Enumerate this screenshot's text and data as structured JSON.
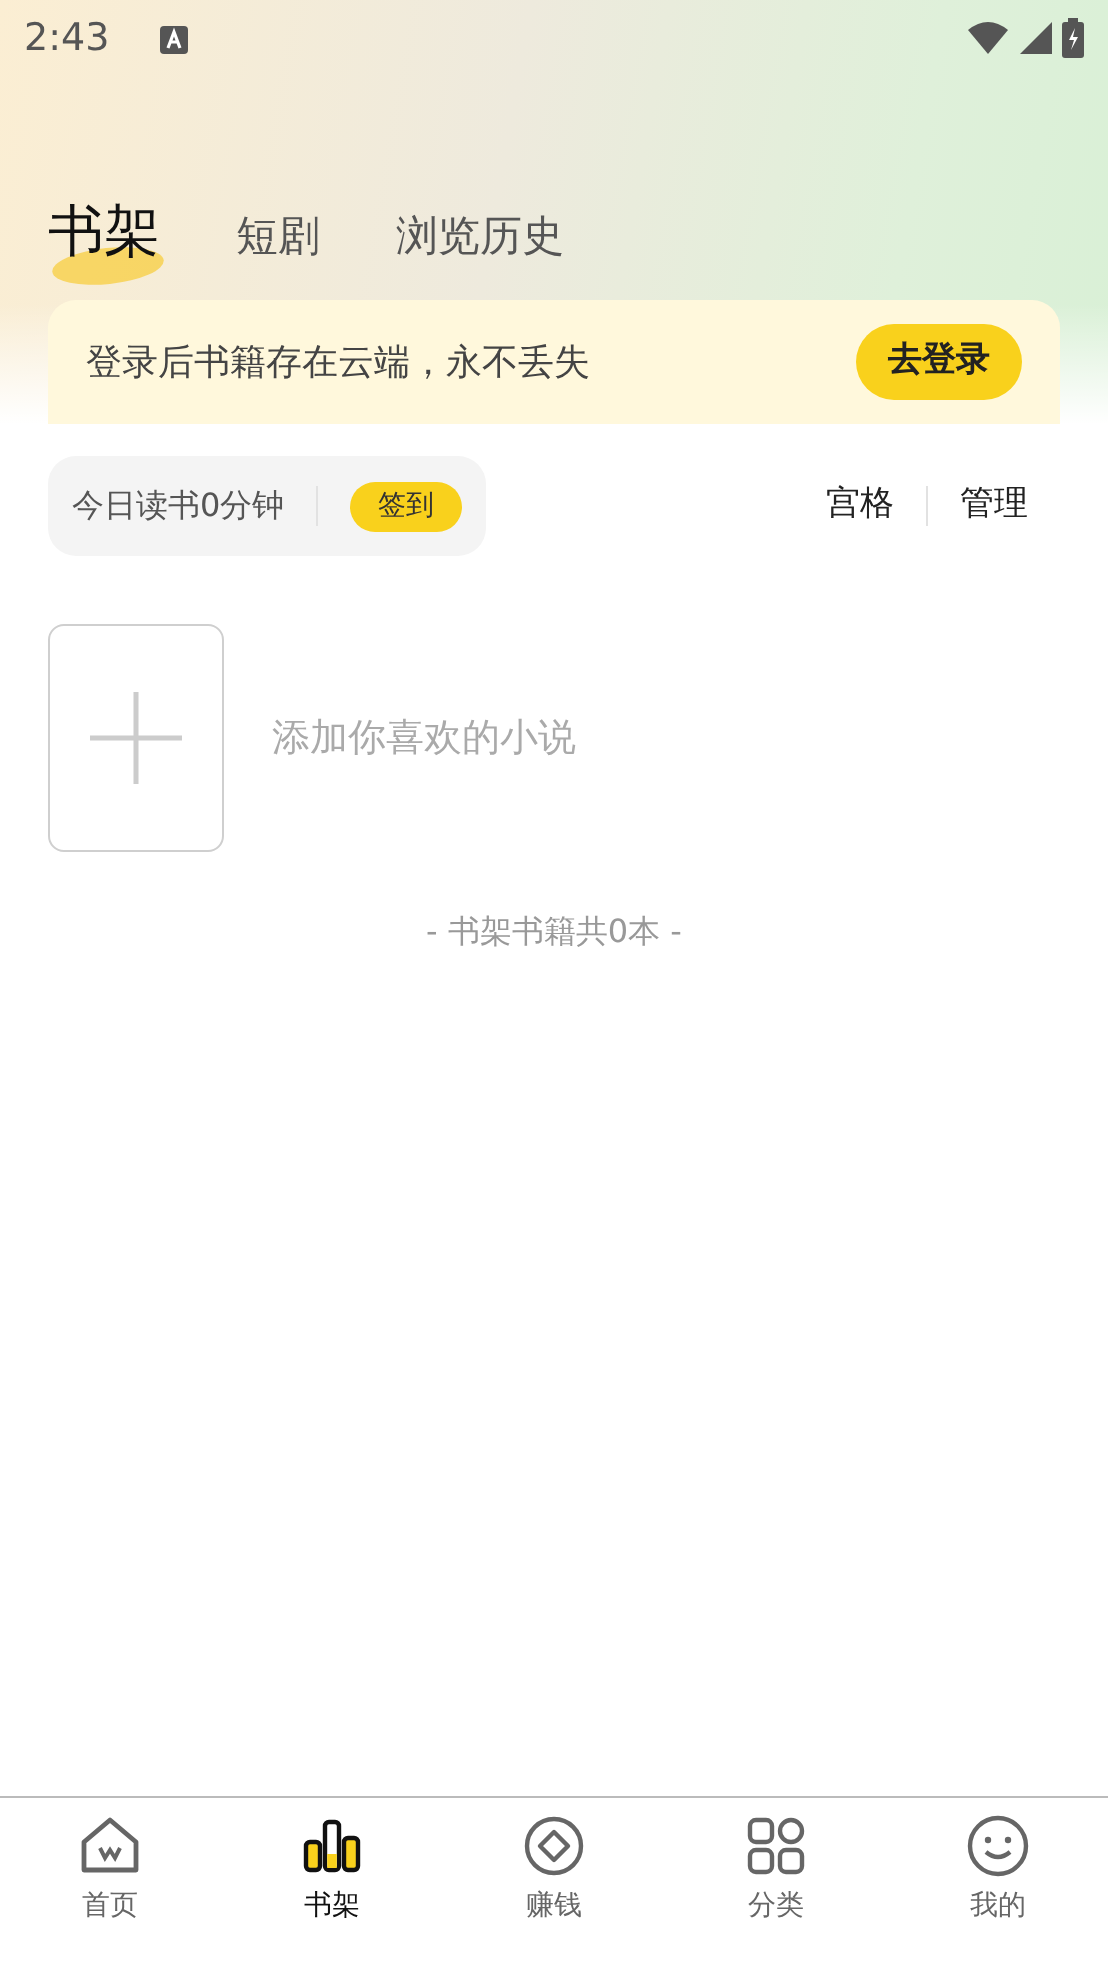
{
  "status_bar": {
    "time": "2:43"
  },
  "tabs": [
    {
      "label": "书架",
      "selected": true
    },
    {
      "label": "短剧",
      "selected": false
    },
    {
      "label": "浏览历史",
      "selected": false
    }
  ],
  "login_banner": {
    "text": "登录后书籍存在云端，永不丢失",
    "button": "去登录"
  },
  "reading": {
    "text": "今日读书0分钟",
    "checkin": "签到"
  },
  "view_actions": [
    "宫格",
    "管理"
  ],
  "add_book": {
    "text": "添加你喜欢的小说"
  },
  "shelf_count": "- 书架书籍共0本 -",
  "bottom_nav": [
    {
      "label": "首页",
      "selected": false
    },
    {
      "label": "书架",
      "selected": true
    },
    {
      "label": "赚钱",
      "selected": false
    },
    {
      "label": "分类",
      "selected": false
    },
    {
      "label": "我的",
      "selected": false
    }
  ]
}
